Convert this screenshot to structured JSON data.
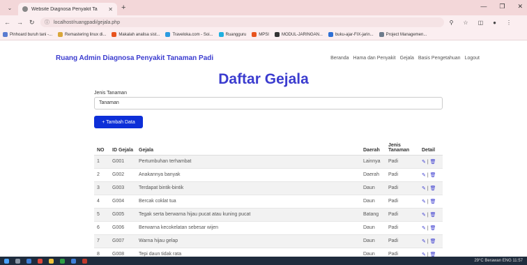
{
  "browser": {
    "tab_title": "Website Diagnosa Penyakit Ta",
    "url": "localhost/ruangpadi/gejala.php",
    "bookmarks": [
      {
        "label": "Pinhoard buruh tani -...",
        "color": "#5a7bd0"
      },
      {
        "label": "Remastering linux di...",
        "color": "#d9a63a"
      },
      {
        "label": "Makalah analisa sist...",
        "color": "#e8531e"
      },
      {
        "label": "Traveloka.com - Soi...",
        "color": "#2d9be0"
      },
      {
        "label": "Ruangguru",
        "color": "#20b0e0"
      },
      {
        "label": "MPSI",
        "color": "#e8531e"
      },
      {
        "label": "MODUL-JARINGAN...",
        "color": "#333333"
      },
      {
        "label": "buku-ajar-FIX-jarin...",
        "color": "#2e6fd4"
      },
      {
        "label": "Project Managemen...",
        "color": "#6e7b8c"
      }
    ]
  },
  "nav": {
    "brand": "Ruang Admin Diagnosa Penyakit Tanaman Padi",
    "menu": [
      "Beranda",
      "Hama dan Penyakit",
      "Gejala",
      "Basis Pengetahuan",
      "Logout"
    ]
  },
  "page": {
    "title": "Daftar Gejala",
    "jenis_label": "Jenis Tanaman",
    "jenis_value": "Tanaman",
    "add_button": "+ Tambah Data"
  },
  "table": {
    "headers": [
      "NO",
      "ID Gejala",
      "Gejala",
      "Daerah",
      "Jenis Tanaman",
      "Detail"
    ],
    "rows": [
      [
        "1",
        "G001",
        "Pertumbuhan terhambat",
        "Lainnya",
        "Padi"
      ],
      [
        "2",
        "G002",
        "Anakannya banyak",
        "Daerah",
        "Padi"
      ],
      [
        "3",
        "G003",
        "Terdapat bintik-bintik",
        "Daun",
        "Padi"
      ],
      [
        "4",
        "G004",
        "Bercak coklat tua",
        "Daun",
        "Padi"
      ],
      [
        "5",
        "G005",
        "Tegak serta berwarna hijau pucat atau kuning pucat",
        "Batang",
        "Padi"
      ],
      [
        "6",
        "G006",
        "Berwarna kecokelatan sebesar wijen",
        "Daun",
        "Padi"
      ],
      [
        "7",
        "G007",
        "Warna hijau gelap",
        "Daun",
        "Padi"
      ],
      [
        "8",
        "G008",
        "Tepi daun tidak rata",
        "Daun",
        "Padi"
      ]
    ]
  },
  "taskbar": {
    "tray": "29°C Berawan  ENG  11:57"
  },
  "colors": {
    "accent": "#3b3ccf",
    "button": "#0d2fd8"
  }
}
